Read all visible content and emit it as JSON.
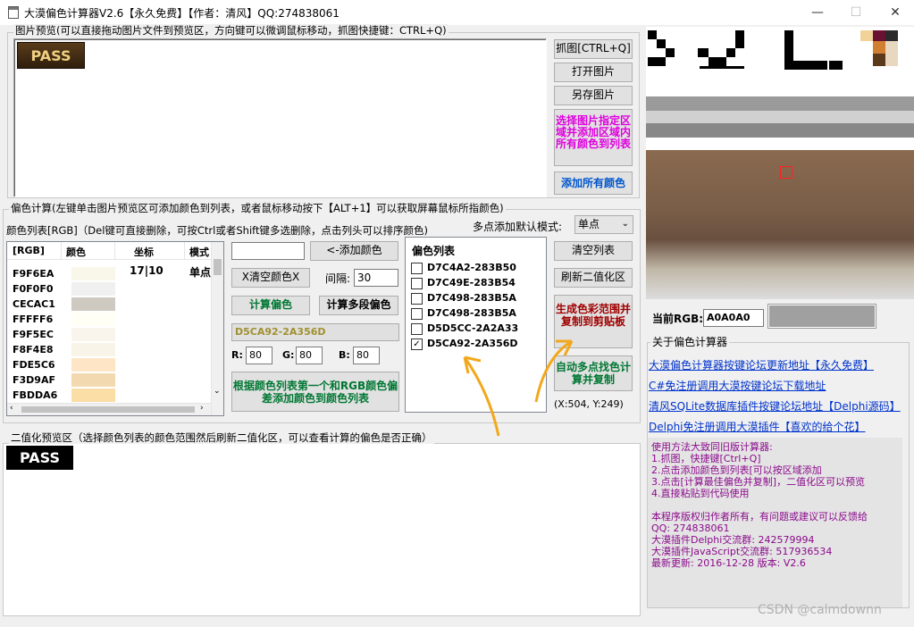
{
  "window": {
    "title": "大漠偏色计算器V2.6【永久免费】【作者：清风】QQ:274838061",
    "min": "—",
    "max": "☐",
    "close": "✕"
  },
  "preview": {
    "group_label": "图片预览(可以直接拖动图片文件到预览区，方向键可以微调鼠标移动，抓图快捷键：CTRL+Q)",
    "pass_text": "PASS"
  },
  "right_buttons": {
    "grab": "抓图[CTRL+Q]",
    "open": "打开图片",
    "save_as": "另存图片",
    "select_region": "选择图片指定区域并添加区域内所有颜色到列表",
    "add_all": "添加所有颜色"
  },
  "calc": {
    "group_label": "偏色计算(左键单击图片预览区可添加颜色到列表，或者鼠标移动按下【ALT+1】可以获取屏幕鼠标所指颜色)",
    "color_list_label": "颜色列表[RGB]（Del键可直接删除，可按Ctrl或者Shift键多选删除，点击列头可以排序颜色)",
    "multipoint_label": "多点添加默认模式:",
    "multipoint_value": "单点",
    "listview": {
      "headers": [
        "[RGB]",
        "颜色",
        "坐标",
        "模式"
      ],
      "first_row_coord": "17|10",
      "first_row_mode": "单点",
      "rows": [
        {
          "rgb": "F9F6EA",
          "color": "#F9F6EA"
        },
        {
          "rgb": "F0F0F0",
          "color": "#F0F0F0"
        },
        {
          "rgb": "CECAC1",
          "color": "#CECAC1"
        },
        {
          "rgb": "FFFFF6",
          "color": "#FFFFF6"
        },
        {
          "rgb": "F9F5EC",
          "color": "#F9F5EC"
        },
        {
          "rgb": "F8F4E8",
          "color": "#F8F4E8"
        },
        {
          "rgb": "FDE5C6",
          "color": "#FDE5C6"
        },
        {
          "rgb": "F3D9AF",
          "color": "#F3D9AF"
        },
        {
          "rgb": "FBDDA6",
          "color": "#FBDDA6"
        }
      ]
    },
    "add_color_btn": "<-添加颜色",
    "clear_color_btn": "X清空颜色X",
    "interval_label": "间隔:",
    "interval_value": "30",
    "calc_offset_btn": "计算偏色",
    "calc_multi_btn": "计算多段偏色",
    "result_value": "D5CA92-2A356D",
    "r_label": "R:",
    "r_value": "80",
    "g_label": "G:",
    "g_value": "80",
    "b_label": "B:",
    "b_value": "80",
    "add_by_first_btn": "根据颜色列表第一个和RGB颜色偏差添加颜色到颜色列表",
    "offset_list": {
      "label": "偏色列表",
      "items": [
        {
          "text": "D7C4A2-283B50",
          "checked": false
        },
        {
          "text": "D7C49E-283B54",
          "checked": false
        },
        {
          "text": "D7C498-283B5A",
          "checked": false
        },
        {
          "text": "D7C498-283B5A",
          "checked": false
        },
        {
          "text": "D5D5CC-2A2A33",
          "checked": false
        },
        {
          "text": "D5CA92-2A356D",
          "checked": true
        }
      ]
    },
    "clear_list_btn": "清空列表",
    "refresh_bin_btn": "刷新二值化区",
    "gen_range_btn": "生成色彩范围并复制到剪贴板",
    "auto_multi_btn": "自动多点找色计算并复制",
    "coord": "(X:504, Y:249)"
  },
  "binary": {
    "group_label": "二值化预览区（选择颜色列表的颜色范围然后刷新二值化区，可以查看计算的偏色是否正确）",
    "pass_text": "PASS"
  },
  "side": {
    "current_rgb_label": "当前RGB:",
    "current_rgb_value": "A0A0A0",
    "current_rgb_color": "#A0A0A0",
    "about_label": "关于偏色计算器",
    "links": [
      "大漠偏色计算器按键论坛更新地址【永久免费】",
      "C#免注册调用大漠按键论坛下载地址",
      "清风SQLite数据库插件按键论坛地址【Delphi源码】",
      "Delphi免注册调用大漠插件【喜欢的给个花】"
    ],
    "info_lines": [
      "使用方法大致同旧版计算器:",
      "1.抓图，快捷键[Ctrl+Q]",
      "2.点击添加颜色到列表[可以按区域添加",
      "3.点击[计算最佳偏色并复制]，二值化区可以预览",
      "4.直接粘贴到代码使用",
      "",
      "本程序版权归作者所有，有问题或建议可以反馈给",
      "QQ: 274838061",
      "大漠插件Delphi交流群: 242579994",
      "大漠插件JavaScript交流群: 517936534",
      "最新更新: 2016-12-28 版本: V2.6"
    ]
  },
  "watermark": "CSDN @calmdownn"
}
